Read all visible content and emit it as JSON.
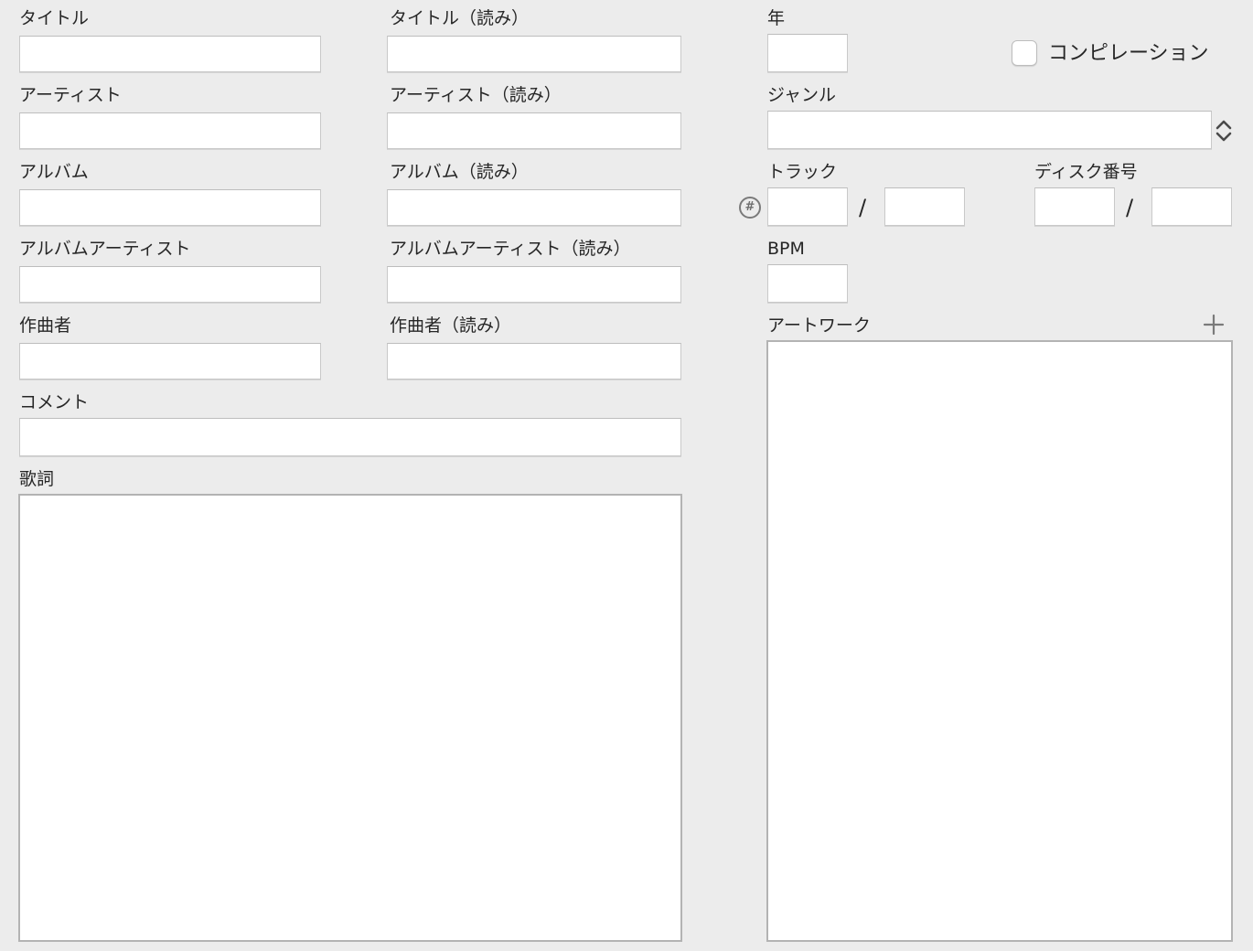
{
  "labels": {
    "title": "タイトル",
    "title_reading": "タイトル（読み）",
    "year": "年",
    "compilation": "コンピレーション",
    "artist": "アーティスト",
    "artist_reading": "アーティスト（読み）",
    "genre": "ジャンル",
    "album": "アルバム",
    "album_reading": "アルバム（読み）",
    "track": "トラック",
    "disc_number": "ディスク番号",
    "album_artist": "アルバムアーティスト",
    "album_artist_reading": "アルバムアーティスト（読み）",
    "bpm": "BPM",
    "composer": "作曲者",
    "composer_reading": "作曲者（読み）",
    "artwork": "アートワーク",
    "comment": "コメント",
    "lyrics": "歌詞"
  },
  "separators": {
    "track": "/",
    "disc": "/"
  },
  "fields": {
    "title": "",
    "title_reading": "",
    "year": "",
    "artist": "",
    "artist_reading": "",
    "genre": "",
    "album": "",
    "album_reading": "",
    "track_number": "",
    "track_total": "",
    "disc_number": "",
    "disc_total": "",
    "album_artist": "",
    "album_artist_reading": "",
    "bpm": "",
    "composer": "",
    "composer_reading": "",
    "comment": "",
    "lyrics": ""
  },
  "state": {
    "compilation_checked": false
  },
  "icons": {
    "track_number_toggle": "hash-icon",
    "genre_stepper": "chevron-up-down-icon",
    "add_artwork": "plus-icon"
  },
  "colors": {
    "background": "#ececec",
    "field_background": "#ffffff",
    "field_border": "#c9c9c9",
    "icon_gray": "#7a7a7a"
  }
}
